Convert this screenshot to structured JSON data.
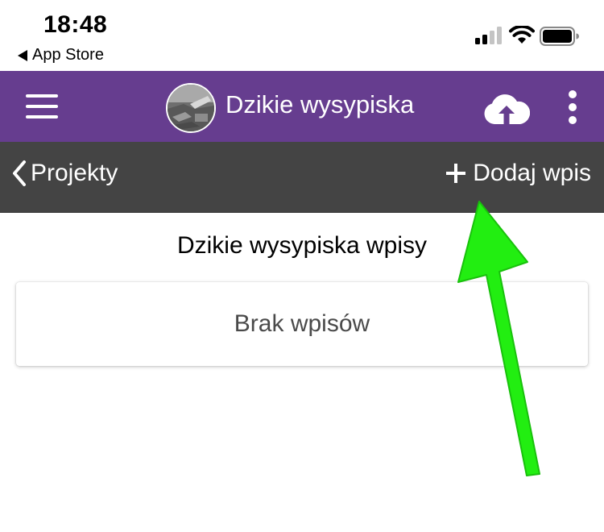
{
  "status_bar": {
    "time": "18:48",
    "back_app": "App Store"
  },
  "app_bar": {
    "title": "Dzikie wysypiska",
    "icons": [
      "menu-icon",
      "upload-cloud-icon",
      "more-vertical-icon"
    ],
    "background_color": "#663d8f"
  },
  "toolbar": {
    "back_label": "Projekty",
    "add_label": "Dodaj wpis",
    "background_color": "#444444"
  },
  "main": {
    "title": "Dzikie wysypiska wpisy",
    "empty_message": "Brak wpisów"
  },
  "annotation": {
    "type": "arrow",
    "color": "#22ee11"
  }
}
